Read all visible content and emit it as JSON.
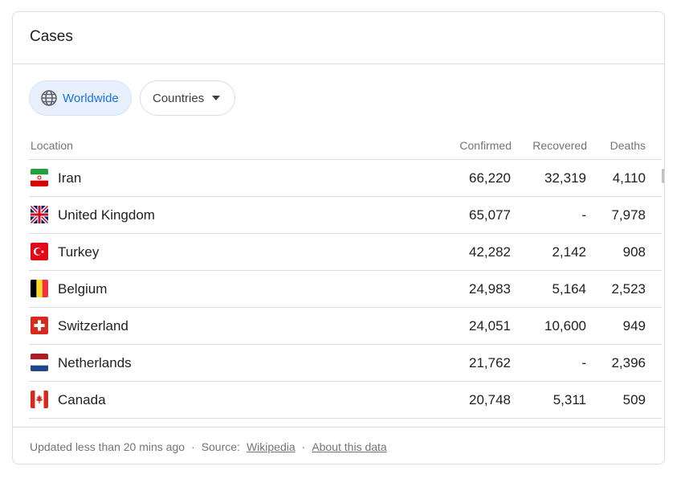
{
  "card": {
    "title": "Cases"
  },
  "filters": {
    "worldwide_label": "Worldwide",
    "countries_label": "Countries"
  },
  "table": {
    "headers": {
      "location": "Location",
      "confirmed": "Confirmed",
      "recovered": "Recovered",
      "deaths": "Deaths"
    },
    "rows": [
      {
        "country": "Iran",
        "flag": "iran-flag-icon",
        "confirmed": "66,220",
        "recovered": "32,319",
        "deaths": "4,110"
      },
      {
        "country": "United Kingdom",
        "flag": "united-kingdom-flag-icon",
        "confirmed": "65,077",
        "recovered": "-",
        "deaths": "7,978"
      },
      {
        "country": "Turkey",
        "flag": "turkey-flag-icon",
        "confirmed": "42,282",
        "recovered": "2,142",
        "deaths": "908"
      },
      {
        "country": "Belgium",
        "flag": "belgium-flag-icon",
        "confirmed": "24,983",
        "recovered": "5,164",
        "deaths": "2,523"
      },
      {
        "country": "Switzerland",
        "flag": "switzerland-flag-icon",
        "confirmed": "24,051",
        "recovered": "10,600",
        "deaths": "949"
      },
      {
        "country": "Netherlands",
        "flag": "netherlands-flag-icon",
        "confirmed": "21,762",
        "recovered": "-",
        "deaths": "2,396"
      },
      {
        "country": "Canada",
        "flag": "canada-flag-icon",
        "confirmed": "20,748",
        "recovered": "5,311",
        "deaths": "509"
      }
    ]
  },
  "footer": {
    "updated": "Updated less than 20 mins ago",
    "source_label": "Source:",
    "source_link": "Wikipedia",
    "about_link": "About this data",
    "separator": "·"
  },
  "colors": {
    "accent": "#1a73e8",
    "chip_selected_bg": "#e8f0fe",
    "border": "#dadce0",
    "muted_text": "#70757a"
  }
}
